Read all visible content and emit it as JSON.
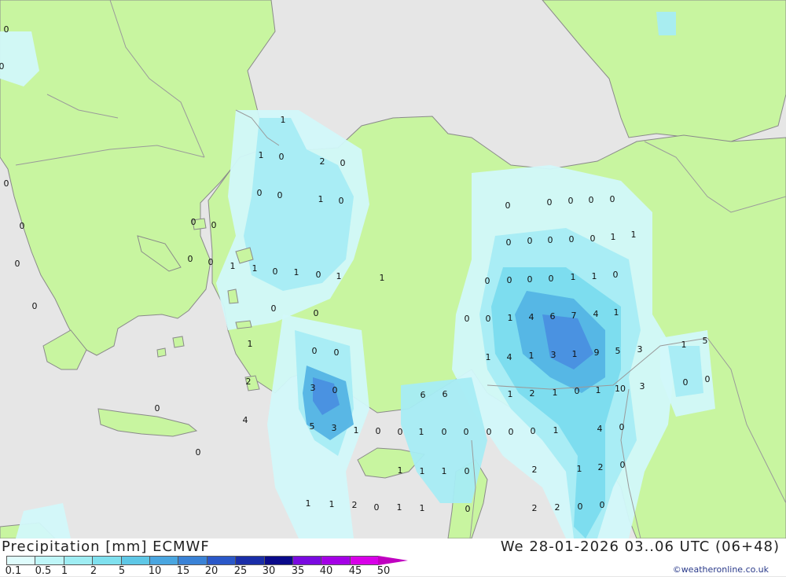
{
  "header": {
    "title": "Precipitation [mm] ECMWF",
    "datetime": "We 28-01-2026 03..06 UTC (06+48)"
  },
  "legend": {
    "ticks": [
      "0.1",
      "0.5",
      "1",
      "2",
      "5",
      "10",
      "15",
      "20",
      "25",
      "30",
      "35",
      "40",
      "45",
      "50"
    ],
    "colors": [
      "#dffcfc",
      "#bff6f8",
      "#9fedf3",
      "#7fe0ee",
      "#5ec7e6",
      "#4aa6e0",
      "#3a82d6",
      "#2a58c8",
      "#1a2ea8",
      "#0a0a8a",
      "#7a0ae0",
      "#a400e6",
      "#d800e8",
      "#c000c0"
    ]
  },
  "map": {
    "colors": {
      "sea": "#e6e6e6",
      "land": "#c8f5a0",
      "border": "#9a9a9a",
      "coast": "#8a8a8a",
      "precip_light": "#d2f8fa",
      "precip_mid": "#a6ecf4",
      "precip_med": "#7adcee",
      "precip_high": "#54b4e4",
      "precip_very_high": "#4a8fe0"
    },
    "values": [
      "0",
      "0",
      "0",
      "0",
      "0",
      "0",
      "0",
      "0",
      "1",
      "1",
      "0",
      "2",
      "0",
      "0",
      "0",
      "1",
      "0",
      "0",
      "0",
      "1",
      "1",
      "0",
      "1",
      "0",
      "1",
      "1",
      "0",
      "0",
      "0",
      "0",
      "0",
      "0",
      "0",
      "0",
      "0",
      "0",
      "0",
      "0",
      "1",
      "1",
      "0",
      "0",
      "0",
      "0",
      "1",
      "1",
      "0",
      "0",
      "0",
      "1",
      "4",
      "6",
      "7",
      "4",
      "1",
      "1",
      "0",
      "0",
      "1",
      "4",
      "1",
      "3",
      "1",
      "9",
      "5",
      "3",
      "1",
      "5",
      "3",
      "0",
      "6",
      "6",
      "1",
      "2",
      "1",
      "0",
      "1",
      "10",
      "3",
      "0",
      "0",
      "2",
      "0",
      "4",
      "5",
      "3",
      "1",
      "0",
      "0",
      "1",
      "0",
      "0",
      "0",
      "0",
      "0",
      "1",
      "4",
      "0",
      "0",
      "1",
      "1",
      "1",
      "0",
      "2",
      "1",
      "2",
      "0",
      "1",
      "1",
      "2",
      "0",
      "1",
      "1",
      "0",
      "2",
      "2",
      "0",
      "0"
    ]
  },
  "credit": "©weatheronline.co.uk"
}
